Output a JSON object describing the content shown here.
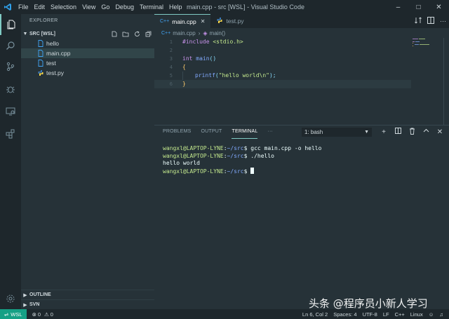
{
  "window": {
    "title": "main.cpp - src [WSL] - Visual Studio Code",
    "menu": [
      "File",
      "Edit",
      "Selection",
      "View",
      "Go",
      "Debug",
      "Terminal",
      "Help"
    ],
    "controls": [
      "minimize-icon",
      "maximize-icon",
      "close-icon"
    ]
  },
  "activity_bar": {
    "items": [
      "files-icon",
      "search-icon",
      "source-control-icon",
      "debug-icon",
      "remote-explorer-icon",
      "extensions-icon"
    ],
    "bottom": "settings-gear-icon"
  },
  "sidebar": {
    "title": "EXPLORER",
    "folder": "SRC [WSL]",
    "files": [
      {
        "name": "hello",
        "icon": "file-icon",
        "selected": false
      },
      {
        "name": "main.cpp",
        "icon": "cpp-icon",
        "selected": true
      },
      {
        "name": "test",
        "icon": "file-icon",
        "selected": false
      },
      {
        "name": "test.py",
        "icon": "python-icon",
        "selected": false
      }
    ],
    "outline": "OUTLINE",
    "svn": "SVN"
  },
  "tabs": [
    {
      "label": "main.cpp",
      "icon": "C++",
      "active": true
    },
    {
      "label": "test.py",
      "icon": "python-icon",
      "active": false
    }
  ],
  "breadcrumb": {
    "file": "main.cpp",
    "symbol": "main()"
  },
  "code": {
    "line_numbers": [
      "1",
      "2",
      "3",
      "4",
      "5",
      "6"
    ],
    "lines": [
      {
        "pp": "#include",
        "inc": "<stdio.h>"
      },
      {},
      {
        "kw": "int",
        "fn": "main",
        "p": "()"
      },
      {
        "br": "{"
      },
      {
        "fn": "printf",
        "p1": "(",
        "str": "\"hello world\\n\"",
        "p2": ");"
      },
      {
        "br": "}"
      }
    ],
    "current_line": 6
  },
  "panel": {
    "tabs": [
      "PROBLEMS",
      "OUTPUT",
      "TERMINAL",
      "···"
    ],
    "active_tab": "TERMINAL",
    "terminal_select": "1: bash",
    "terminal": [
      {
        "user": "wangxl@LAPTOP-LYNE",
        "sep": ":",
        "path": "~/src",
        "cmd": "$ gcc main.cpp -o hello"
      },
      {
        "user": "wangxl@LAPTOP-LYNE",
        "sep": ":",
        "path": "~/src",
        "cmd": "$ ./hello"
      },
      {
        "plain": "hello world"
      },
      {
        "user": "wangxl@LAPTOP-LYNE",
        "sep": ":",
        "path": "~/src",
        "cmd": "$ "
      }
    ]
  },
  "statusbar": {
    "remote": "WSL",
    "errors": "0",
    "warnings": "0",
    "position": "Ln 6, Col 2",
    "spaces": "Spaces: 4",
    "encoding": "UTF-8",
    "eol": "LF",
    "language": "C++",
    "os": "Linux"
  },
  "watermark": "头条 @程序员小新人学习",
  "colors": {
    "accent": "#80cbc4",
    "remote": "#16a085",
    "background": "#263238"
  }
}
